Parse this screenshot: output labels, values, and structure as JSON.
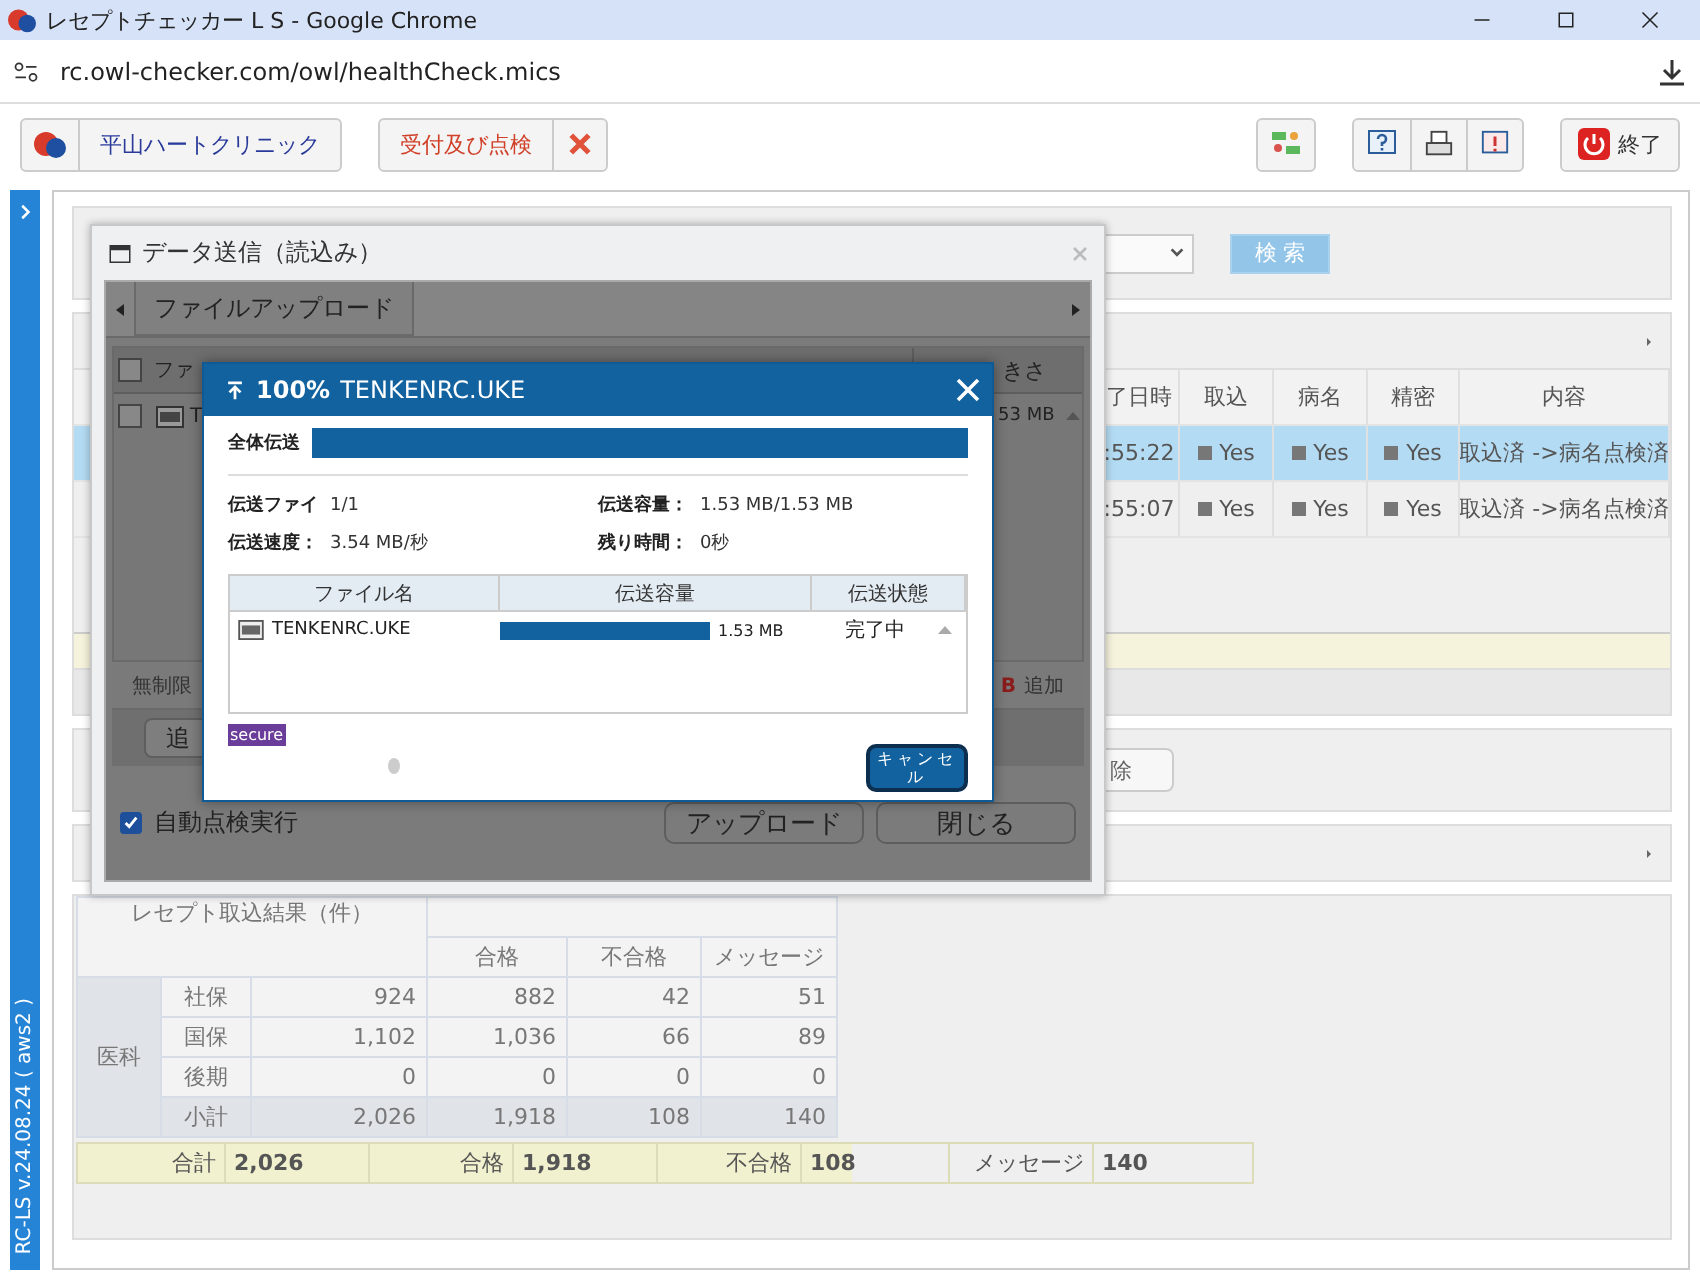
{
  "browser": {
    "title": "レセプトチェッカー L S  - Google Chrome",
    "url": "rc.owl-checker.com/owl/healthCheck.mics"
  },
  "toolbar": {
    "clinic": "平山ハートクリニック",
    "mode": "受付及び点検",
    "exit": "終了"
  },
  "sidebar": {
    "version": "RC-LS v.24.08.24 ( aws2 )"
  },
  "search": {
    "button": "検 索"
  },
  "results": {
    "columns": [
      "了日時",
      "取込",
      "病名",
      "精密",
      "内容"
    ],
    "rows": [
      {
        "selected": true,
        "cells": [
          ":55:22",
          "Yes",
          "Yes",
          "Yes",
          "取込済 ->病名点検済"
        ]
      },
      {
        "selected": false,
        "cells": [
          ":55:07",
          "Yes",
          "Yes",
          "Yes",
          "取込済 ->病名点検済"
        ]
      }
    ]
  },
  "partial_button": "除",
  "stats": {
    "title": "レセプト取込結果（件）",
    "columns": [
      "合格",
      "不合格",
      "メッセージ"
    ],
    "group": "医科",
    "rows": [
      {
        "kind": "data",
        "label": "社保",
        "values": [
          "924",
          "882",
          "42",
          "51"
        ]
      },
      {
        "kind": "data",
        "label": "国保",
        "values": [
          "1,102",
          "1,036",
          "66",
          "89"
        ]
      },
      {
        "kind": "data",
        "label": "後期",
        "values": [
          "0",
          "0",
          "0",
          "0"
        ]
      },
      {
        "kind": "subtotal",
        "label": "小計",
        "values": [
          "2,026",
          "1,918",
          "108",
          "140"
        ]
      }
    ],
    "totals": [
      {
        "label": "合計",
        "value": "2,026"
      },
      {
        "label": "合格",
        "value": "1,918"
      },
      {
        "label": "不合格",
        "value": "108"
      },
      {
        "label": "メッセージ",
        "value": "140"
      }
    ]
  },
  "dialog": {
    "title": "データ送信（読込み）",
    "tab": "ファイルアップロード",
    "header_checkbox": {
      "checked": false
    },
    "file_column": "ファ",
    "size_column": "きさ",
    "file_checked": false,
    "file_name": "T",
    "file_size": "53 MB",
    "limit": "無制限",
    "add_prefix": "B",
    "add": "追加",
    "add_button": "追",
    "auto_check": {
      "label": "自動点検実行",
      "checked": true
    },
    "buttons": [
      "アップロード",
      "閉じる"
    ]
  },
  "upload": {
    "percent": "100%",
    "filename": "TENKENRC.UKE",
    "overall": {
      "label": "全体伝送",
      "level": 1
    },
    "stats": [
      {
        "label": "伝送ファイ",
        "value": "1/1"
      },
      {
        "label": "伝送容量：",
        "value": "1.53 MB/1.53 MB"
      },
      {
        "label": "伝送速度：",
        "value": "3.54 MB/秒"
      },
      {
        "label": "残り時間：",
        "value": "0秒"
      }
    ],
    "columns": [
      "ファイル名",
      "伝送容量",
      "伝送状態"
    ],
    "files": [
      {
        "name": "TENKENRC.UKE",
        "level": 1,
        "size": "1.53 MB",
        "status": "完了中"
      }
    ],
    "badge": "secure",
    "cancel": "キャンセル"
  }
}
